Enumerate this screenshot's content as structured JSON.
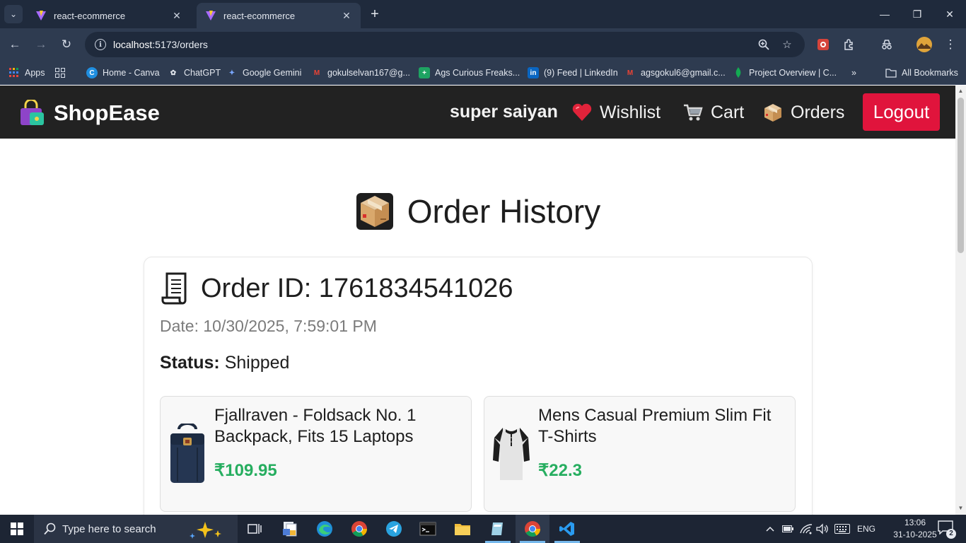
{
  "browser": {
    "tabs": [
      {
        "title": "react-ecommerce",
        "active": false
      },
      {
        "title": "react-ecommerce",
        "active": true
      }
    ],
    "url_host": "localhost",
    "url_path": ":5173/orders",
    "bookmarks": [
      {
        "label": "Apps",
        "icon": "apps-grid-icon"
      },
      {
        "label": "Home - Canva",
        "icon": "canva-icon"
      },
      {
        "label": "ChatGPT",
        "icon": "chatgpt-icon"
      },
      {
        "label": "Google Gemini",
        "icon": "gemini-icon"
      },
      {
        "label": "gokulselvan167@g...",
        "icon": "gmail-icon"
      },
      {
        "label": "Ags Curious Freaks...",
        "icon": "sheets-icon"
      },
      {
        "label": "(9) Feed | LinkedIn",
        "icon": "linkedin-icon"
      },
      {
        "label": "agsgokul6@gmail.c...",
        "icon": "gmail-icon"
      },
      {
        "label": "Project Overview | C...",
        "icon": "mongodb-icon"
      }
    ],
    "all_bookmarks_label": "All Bookmarks"
  },
  "navbar": {
    "brand": "ShopEase",
    "user": "super saiyan",
    "links": [
      {
        "label": "Wishlist",
        "icon": "heart-icon"
      },
      {
        "label": "Cart",
        "icon": "cart-icon"
      },
      {
        "label": "Orders",
        "icon": "package-icon"
      }
    ],
    "logout_label": "Logout",
    "logout_color": "#e0143c"
  },
  "page": {
    "title": "Order History",
    "order": {
      "id_text": "Order ID: 1761834541026",
      "date_text": "Date: 10/30/2025, 7:59:01 PM",
      "status_label": "Status:",
      "status_value": "Shipped",
      "items": [
        {
          "name": "Fjallraven - Foldsack No. 1 Backpack, Fits 15 Laptops",
          "price": "₹109.95",
          "image": "backpack"
        },
        {
          "name": "Mens Casual Premium Slim Fit T-Shirts",
          "price": "₹22.3",
          "image": "tshirt"
        }
      ]
    },
    "price_color": "#27ae60"
  },
  "taskbar": {
    "search_placeholder": "Type here to search",
    "language": "ENG",
    "time": "13:06",
    "date": "31-10-2025",
    "notification_count": "2"
  }
}
